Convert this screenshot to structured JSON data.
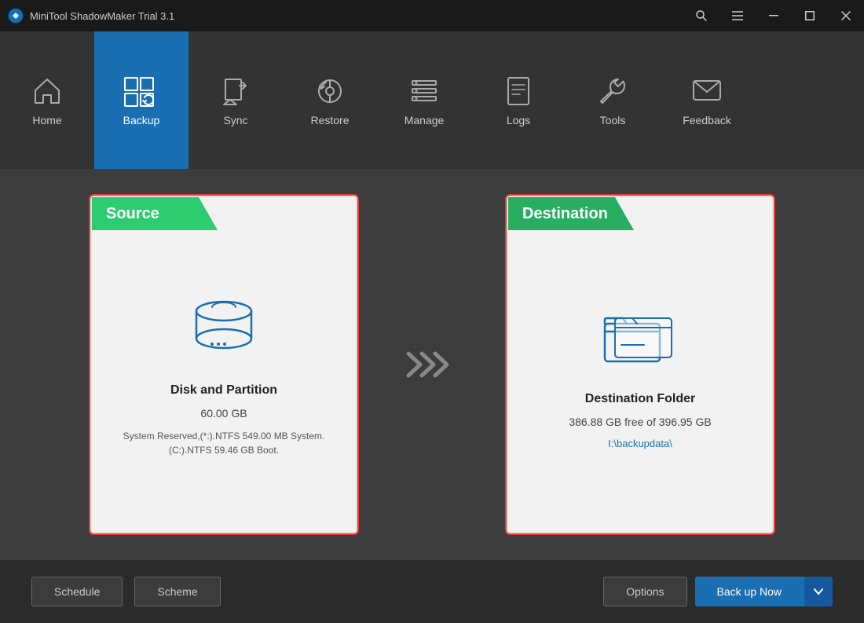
{
  "titleBar": {
    "appIcon": "🔵",
    "title": "MiniTool ShadowMaker Trial 3.1",
    "controls": {
      "search": "🔍",
      "menu": "☰",
      "minimize": "─",
      "maximize": "□",
      "close": "✕"
    }
  },
  "nav": {
    "items": [
      {
        "id": "home",
        "label": "Home",
        "active": false
      },
      {
        "id": "backup",
        "label": "Backup",
        "active": true
      },
      {
        "id": "sync",
        "label": "Sync",
        "active": false
      },
      {
        "id": "restore",
        "label": "Restore",
        "active": false
      },
      {
        "id": "manage",
        "label": "Manage",
        "active": false
      },
      {
        "id": "logs",
        "label": "Logs",
        "active": false
      },
      {
        "id": "tools",
        "label": "Tools",
        "active": false
      },
      {
        "id": "feedback",
        "label": "Feedback",
        "active": false
      }
    ]
  },
  "source": {
    "header": "Source",
    "title": "Disk and Partition",
    "size": "60.00 GB",
    "description": "System Reserved,(*:).NTFS 549.00 MB System.\n(C:).NTFS 59.46 GB Boot."
  },
  "destination": {
    "header": "Destination",
    "title": "Destination Folder",
    "freeSpace": "386.88 GB free of 396.95 GB",
    "path": "I:\\backupdata\\"
  },
  "bottomBar": {
    "schedule": "Schedule",
    "scheme": "Scheme",
    "options": "Options",
    "backupNow": "Back up Now"
  }
}
